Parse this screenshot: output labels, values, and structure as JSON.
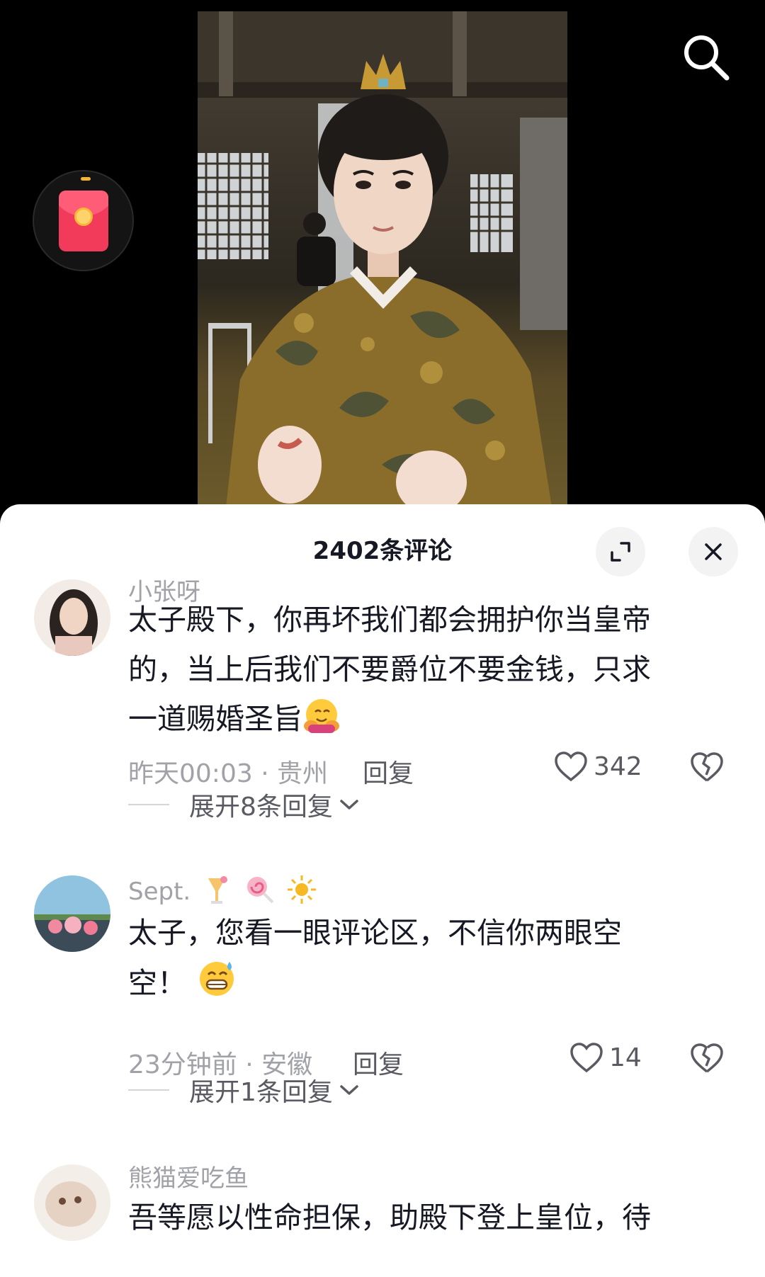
{
  "video": {
    "search_icon": "search-icon",
    "redpack_icon": "red-envelope-icon"
  },
  "sheet": {
    "title": "2402条评论",
    "expand_icon": "expand-icon",
    "close_icon": "close-icon"
  },
  "comments": [
    {
      "user": "小张呀",
      "text": "太子殿下，你再坏我们都会拥护你当皇帝的，当上后我们不要爵位不要金钱，只求一道赐婚圣旨",
      "text_lines": [
        "太子殿下，你再坏我们都会拥护你当皇帝",
        "的，当上后我们不要爵位不要金钱，只求",
        "一道赐婚圣旨"
      ],
      "emoji": "hugging-face-emoji",
      "meta": "昨天00:03 · 贵州",
      "reply_label": "回复",
      "likes": "342",
      "expand_label": "展开8条回复"
    },
    {
      "user": "Sept.",
      "user_emojis": [
        "tropical-drink-emoji",
        "lollipop-emoji",
        "sun-emoji"
      ],
      "text": "太子，您看一眼评论区，不信你两眼空空！",
      "text_lines": [
        "太子，您看一眼评论区，不信你两眼空",
        "空！"
      ],
      "emoji": "grinning-sweat-emoji",
      "meta": "23分钟前 · 安徽",
      "reply_label": "回复",
      "likes": "14",
      "expand_label": "展开1条回复"
    },
    {
      "user": "熊猫爱吃鱼",
      "text_lines": [
        "吾等愿以性命担保，助殿下登上皇位，待"
      ]
    }
  ]
}
